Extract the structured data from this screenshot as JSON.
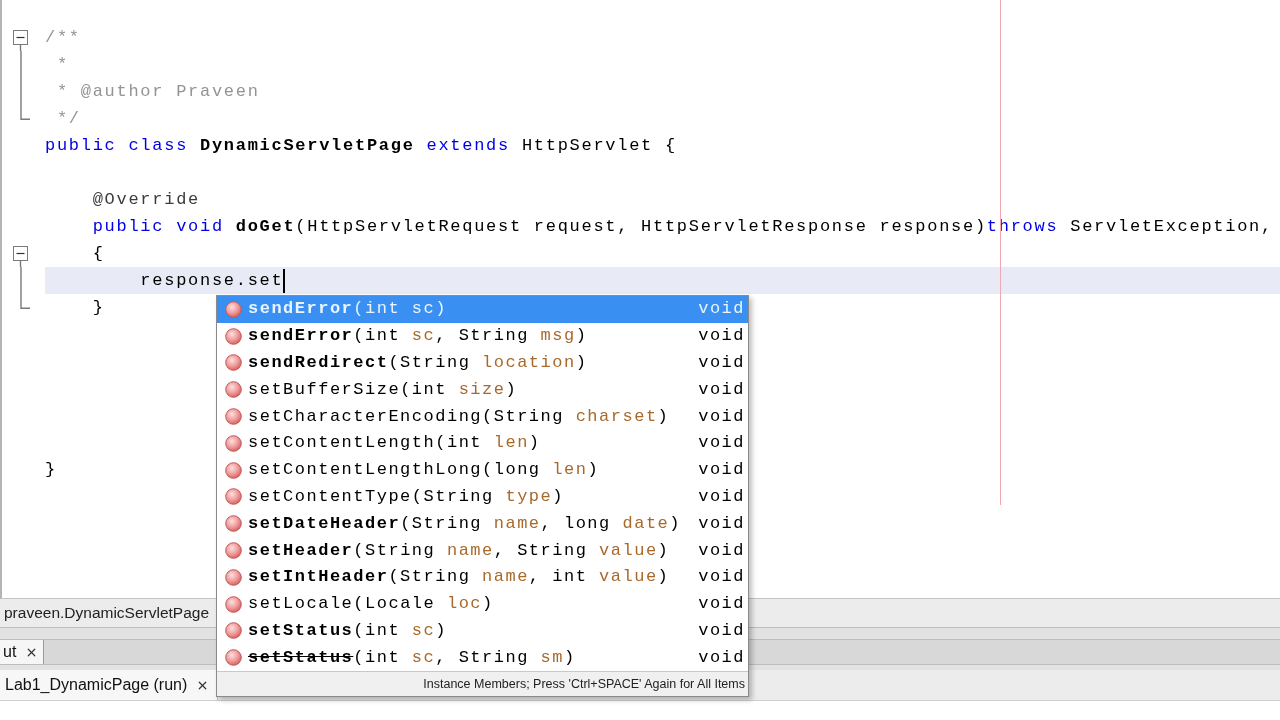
{
  "editor": {
    "lines": [
      {
        "kind": "fold-start",
        "tokens": [
          {
            "text": "/**",
            "kind": "comment"
          }
        ],
        "current": false
      },
      {
        "kind": "fold-line",
        "tokens": [
          {
            "text": " *",
            "kind": "comment"
          }
        ],
        "current": false
      },
      {
        "kind": "fold-line",
        "tokens": [
          {
            "text": " * @author Praveen",
            "kind": "comment"
          }
        ],
        "current": false
      },
      {
        "kind": "fold-end",
        "tokens": [
          {
            "text": " */",
            "kind": "comment"
          }
        ],
        "current": false
      },
      {
        "kind": "plain",
        "tokens": [
          {
            "text": "public class ",
            "kind": "keyword"
          },
          {
            "text": "DynamicServletPage ",
            "kind": "declaration"
          },
          {
            "text": "extends ",
            "kind": "keyword"
          },
          {
            "text": "HttpServlet {",
            "kind": "plain"
          }
        ],
        "current": false
      },
      {
        "kind": "plain",
        "current": false
      },
      {
        "kind": "plain",
        "tokens": [
          {
            "text": "    @Override",
            "kind": "annotation"
          }
        ],
        "current": false
      },
      {
        "kind": "plain",
        "tokens": [
          {
            "text": "    public void ",
            "kind": "keyword"
          },
          {
            "text": "doGet",
            "kind": "declaration"
          },
          {
            "text": "(HttpServletRequest request, HttpServletResponse response)",
            "kind": "plain"
          },
          {
            "text": "throws ",
            "kind": "keyword"
          },
          {
            "text": "ServletException,",
            "kind": "plain"
          }
        ],
        "current": false
      },
      {
        "kind": "fold-start",
        "tokens": [
          {
            "text": "    {",
            "kind": "plain"
          }
        ],
        "current": false
      },
      {
        "kind": "fold-line",
        "tokens": [
          {
            "text": "        response.set",
            "kind": "plain"
          }
        ],
        "current": true
      },
      {
        "kind": "fold-end",
        "tokens": [
          {
            "text": "    }",
            "kind": "plain"
          }
        ],
        "current": false
      },
      {
        "kind": "plain",
        "current": false
      },
      {
        "kind": "plain",
        "current": false
      },
      {
        "kind": "plain",
        "current": false
      },
      {
        "kind": "plain",
        "current": false
      },
      {
        "kind": "plain",
        "current": false
      },
      {
        "kind": "plain",
        "tokens": [
          {
            "text": "}",
            "kind": "plain"
          }
        ],
        "current": false
      }
    ]
  },
  "completion_popup": {
    "items": [
      {
        "name": "sendError",
        "bold": true,
        "deprecated": false,
        "selected": true,
        "args": [
          {
            "text": "(int ",
            "kind": "type"
          },
          {
            "text": "sc",
            "kind": "param"
          },
          {
            "text": ")",
            "kind": "type"
          }
        ],
        "return_type": "void"
      },
      {
        "name": "sendError",
        "bold": true,
        "deprecated": false,
        "selected": false,
        "args": [
          {
            "text": "(int ",
            "kind": "type"
          },
          {
            "text": "sc",
            "kind": "param"
          },
          {
            "text": ", String ",
            "kind": "type"
          },
          {
            "text": "msg",
            "kind": "param"
          },
          {
            "text": ")",
            "kind": "type"
          }
        ],
        "return_type": "void"
      },
      {
        "name": "sendRedirect",
        "bold": true,
        "deprecated": false,
        "selected": false,
        "args": [
          {
            "text": "(String ",
            "kind": "type"
          },
          {
            "text": "location",
            "kind": "param"
          },
          {
            "text": ")",
            "kind": "type"
          }
        ],
        "return_type": "void"
      },
      {
        "name": "setBufferSize",
        "bold": false,
        "deprecated": false,
        "selected": false,
        "args": [
          {
            "text": "(int ",
            "kind": "type"
          },
          {
            "text": "size",
            "kind": "param"
          },
          {
            "text": ")",
            "kind": "type"
          }
        ],
        "return_type": "void"
      },
      {
        "name": "setCharacterEncoding",
        "bold": false,
        "deprecated": false,
        "selected": false,
        "args": [
          {
            "text": "(String ",
            "kind": "type"
          },
          {
            "text": "charset",
            "kind": "param"
          },
          {
            "text": ")",
            "kind": "type"
          }
        ],
        "return_type": "void"
      },
      {
        "name": "setContentLength",
        "bold": false,
        "deprecated": false,
        "selected": false,
        "args": [
          {
            "text": "(int ",
            "kind": "type"
          },
          {
            "text": "len",
            "kind": "param"
          },
          {
            "text": ")",
            "kind": "type"
          }
        ],
        "return_type": "void"
      },
      {
        "name": "setContentLengthLong",
        "bold": false,
        "deprecated": false,
        "selected": false,
        "args": [
          {
            "text": "(long ",
            "kind": "type"
          },
          {
            "text": "len",
            "kind": "param"
          },
          {
            "text": ")",
            "kind": "type"
          }
        ],
        "return_type": "void"
      },
      {
        "name": "setContentType",
        "bold": false,
        "deprecated": false,
        "selected": false,
        "args": [
          {
            "text": "(String ",
            "kind": "type"
          },
          {
            "text": "type",
            "kind": "param"
          },
          {
            "text": ")",
            "kind": "type"
          }
        ],
        "return_type": "void"
      },
      {
        "name": "setDateHeader",
        "bold": true,
        "deprecated": false,
        "selected": false,
        "args": [
          {
            "text": "(String ",
            "kind": "type"
          },
          {
            "text": "name",
            "kind": "param"
          },
          {
            "text": ", long ",
            "kind": "type"
          },
          {
            "text": "date",
            "kind": "param"
          },
          {
            "text": ")",
            "kind": "type"
          }
        ],
        "return_type": "void"
      },
      {
        "name": "setHeader",
        "bold": true,
        "deprecated": false,
        "selected": false,
        "args": [
          {
            "text": "(String ",
            "kind": "type"
          },
          {
            "text": "name",
            "kind": "param"
          },
          {
            "text": ", String ",
            "kind": "type"
          },
          {
            "text": "value",
            "kind": "param"
          },
          {
            "text": ")",
            "kind": "type"
          }
        ],
        "return_type": "void"
      },
      {
        "name": "setIntHeader",
        "bold": true,
        "deprecated": false,
        "selected": false,
        "args": [
          {
            "text": "(String ",
            "kind": "type"
          },
          {
            "text": "name",
            "kind": "param"
          },
          {
            "text": ", int ",
            "kind": "type"
          },
          {
            "text": "value",
            "kind": "param"
          },
          {
            "text": ")",
            "kind": "type"
          }
        ],
        "return_type": "void"
      },
      {
        "name": "setLocale",
        "bold": false,
        "deprecated": false,
        "selected": false,
        "args": [
          {
            "text": "(Locale ",
            "kind": "type"
          },
          {
            "text": "loc",
            "kind": "param"
          },
          {
            "text": ")",
            "kind": "type"
          }
        ],
        "return_type": "void"
      },
      {
        "name": "setStatus",
        "bold": true,
        "deprecated": false,
        "selected": false,
        "args": [
          {
            "text": "(int ",
            "kind": "type"
          },
          {
            "text": "sc",
            "kind": "param"
          },
          {
            "text": ")",
            "kind": "type"
          }
        ],
        "return_type": "void"
      },
      {
        "name": "setStatus",
        "bold": true,
        "deprecated": true,
        "selected": false,
        "args": [
          {
            "text": "(int ",
            "kind": "type"
          },
          {
            "text": "sc",
            "kind": "param"
          },
          {
            "text": ", String ",
            "kind": "type"
          },
          {
            "text": "sm",
            "kind": "param"
          },
          {
            "text": ")",
            "kind": "type"
          }
        ],
        "return_type": "void"
      }
    ],
    "hint": "Instance Members; Press 'Ctrl+SPACE' Again for All Items"
  },
  "navigator": {
    "path": "praveen.DynamicServletPage"
  },
  "panel_tabs": [
    {
      "label": "ut",
      "selected": true
    }
  ],
  "output_tabs": [
    {
      "label": "Lab1_DynamicPage (run)",
      "selected": true
    }
  ]
}
